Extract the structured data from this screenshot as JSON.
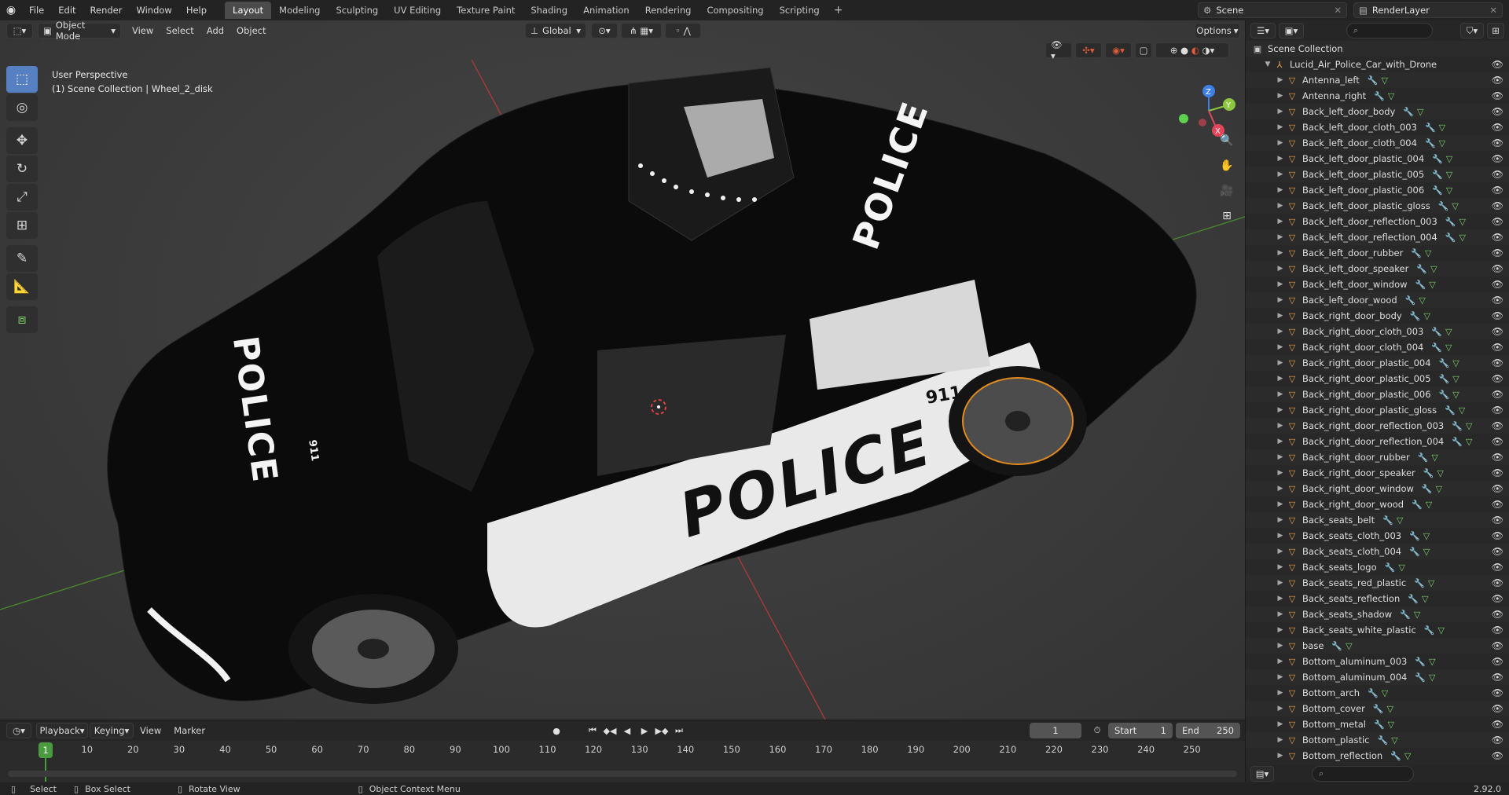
{
  "topbar": {
    "menus": [
      "File",
      "Edit",
      "Render",
      "Window",
      "Help"
    ],
    "workspaces": [
      "Layout",
      "Modeling",
      "Sculpting",
      "UV Editing",
      "Texture Paint",
      "Shading",
      "Animation",
      "Rendering",
      "Compositing",
      "Scripting"
    ],
    "active_workspace": "Layout",
    "scene_name": "Scene",
    "view_layer": "RenderLayer"
  },
  "viewport": {
    "mode": "Object Mode",
    "menus": [
      "View",
      "Select",
      "Add",
      "Object"
    ],
    "orientation": "Global",
    "options_label": "Options",
    "perspective_label": "User Perspective",
    "context_label": "(1) Scene Collection | Wheel_2_disk",
    "car_texts": {
      "hood": "POLICE",
      "side": "POLICE",
      "roof": "POLICE",
      "door_number": "911",
      "hood_number": "911"
    },
    "gizmo_axes": [
      "X",
      "Y",
      "Z"
    ],
    "colors": {
      "x_axis": "#e3455a",
      "y_axis": "#8cc73f",
      "z_axis": "#3f7fe6"
    }
  },
  "timeline": {
    "menus": [
      "Playback",
      "Keying",
      "View",
      "Marker"
    ],
    "current_frame": "1",
    "start_label": "Start",
    "start_value": "1",
    "end_label": "End",
    "end_value": "250",
    "ruler_marks": [
      "1",
      "10",
      "20",
      "30",
      "40",
      "50",
      "60",
      "70",
      "80",
      "90",
      "100",
      "110",
      "120",
      "130",
      "140",
      "150",
      "160",
      "170",
      "180",
      "190",
      "200",
      "210",
      "220",
      "230",
      "240",
      "250"
    ]
  },
  "statusbar": {
    "select": "Select",
    "box_select": "Box Select",
    "rotate_view": "Rotate View",
    "context_menu": "Object Context Menu",
    "version": "2.92.0"
  },
  "outliner": {
    "root": "Scene Collection",
    "collection": "Lucid_Air_Police_Car_with_Drone",
    "items": [
      "Antenna_left",
      "Antenna_right",
      "Back_left_door_body",
      "Back_left_door_cloth_003",
      "Back_left_door_cloth_004",
      "Back_left_door_plastic_004",
      "Back_left_door_plastic_005",
      "Back_left_door_plastic_006",
      "Back_left_door_plastic_gloss",
      "Back_left_door_reflection_003",
      "Back_left_door_reflection_004",
      "Back_left_door_rubber",
      "Back_left_door_speaker",
      "Back_left_door_window",
      "Back_left_door_wood",
      "Back_right_door_body",
      "Back_right_door_cloth_003",
      "Back_right_door_cloth_004",
      "Back_right_door_plastic_004",
      "Back_right_door_plastic_005",
      "Back_right_door_plastic_006",
      "Back_right_door_plastic_gloss",
      "Back_right_door_reflection_003",
      "Back_right_door_reflection_004",
      "Back_right_door_rubber",
      "Back_right_door_speaker",
      "Back_right_door_window",
      "Back_right_door_wood",
      "Back_seats_belt",
      "Back_seats_cloth_003",
      "Back_seats_cloth_004",
      "Back_seats_logo",
      "Back_seats_red_plastic",
      "Back_seats_reflection",
      "Back_seats_shadow",
      "Back_seats_white_plastic",
      "base",
      "Bottom_aluminum_003",
      "Bottom_aluminum_004",
      "Bottom_arch",
      "Bottom_cover",
      "Bottom_metal",
      "Bottom_plastic",
      "Bottom_reflection"
    ]
  }
}
